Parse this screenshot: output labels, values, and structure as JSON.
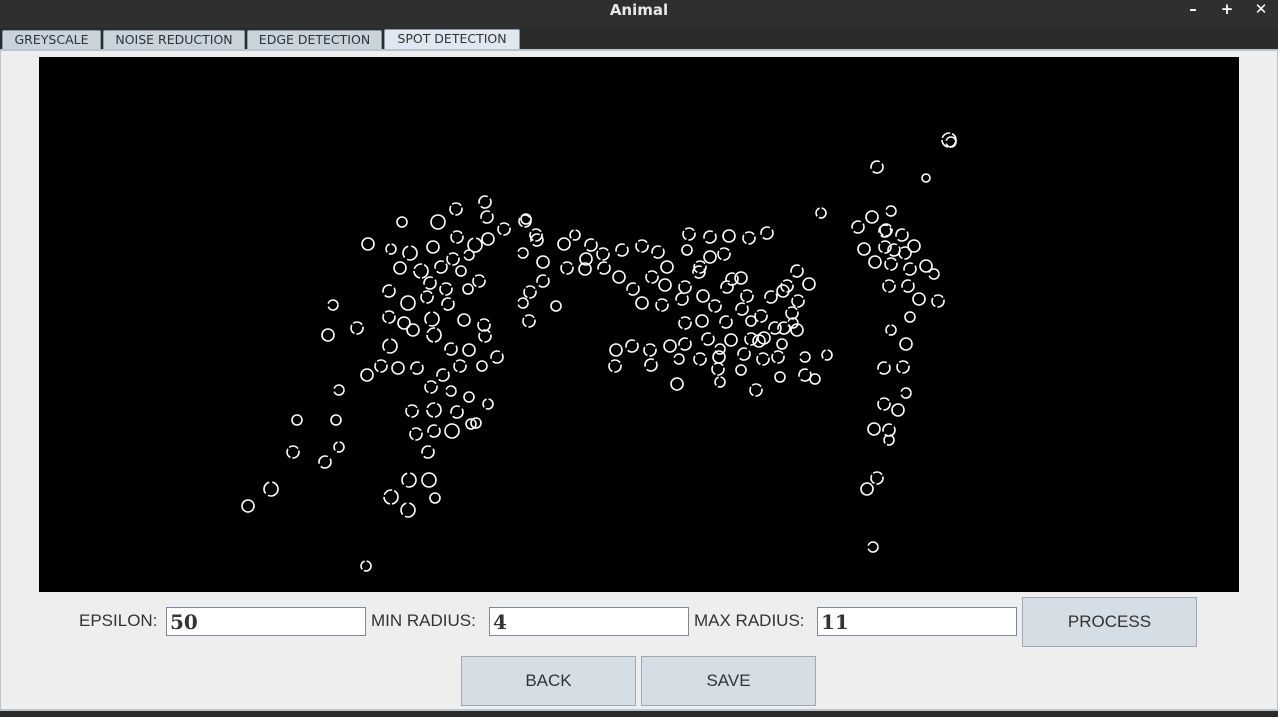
{
  "window": {
    "title": "Animal",
    "minimize_label": "–",
    "maximize_label": "+",
    "close_label": "✕"
  },
  "tabs": [
    {
      "label": "GREYSCALE",
      "active": false
    },
    {
      "label": "NOISE REDUCTION",
      "active": false
    },
    {
      "label": "EDGE DETECTION",
      "active": false
    },
    {
      "label": "SPOT DETECTION",
      "active": true
    }
  ],
  "image": {
    "background": "#000000",
    "spot_color": "#ffffff"
  },
  "controls": {
    "epsilon_label": "EPSILON:",
    "epsilon_value": "50",
    "min_radius_label": "MIN RADIUS:",
    "min_radius_value": "4",
    "max_radius_label": "MAX RADIUS:",
    "max_radius_value": "11",
    "process_label": "PROCESS",
    "back_label": "BACK",
    "save_label": "SAVE"
  }
}
